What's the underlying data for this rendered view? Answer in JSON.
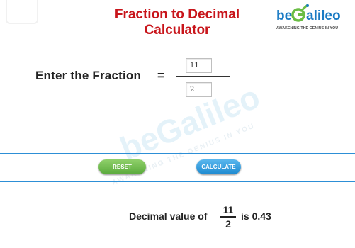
{
  "header": {
    "title_line1": "Fraction to Decimal",
    "title_line2": "Calculator"
  },
  "logo": {
    "word_prefix": "be",
    "word_g": "G",
    "word_suffix": "alileo",
    "tagline": "AWAKENING THE GENIUS IN YOU",
    "colors": {
      "be": "#1b7bc4",
      "g": "#6abd45",
      "alileo": "#1b7bc4"
    }
  },
  "watermark": {
    "word": "beGalileo",
    "tagline": "AWAKENING THE GENIUS IN YOU"
  },
  "form": {
    "label": "Enter the Fraction",
    "equals": "=",
    "numerator_value": "11",
    "denominator_value": "2"
  },
  "buttons": {
    "reset_label": "RESET",
    "calculate_label": "CALCULATE"
  },
  "result": {
    "prefix": "Decimal value of",
    "numerator": "11",
    "denominator": "2",
    "suffix": "is 0.43"
  },
  "colors": {
    "title": "#c8151b",
    "divider": "#2d8fd6",
    "reset_button": "#6abd45",
    "calculate_button": "#2d8fd6"
  }
}
